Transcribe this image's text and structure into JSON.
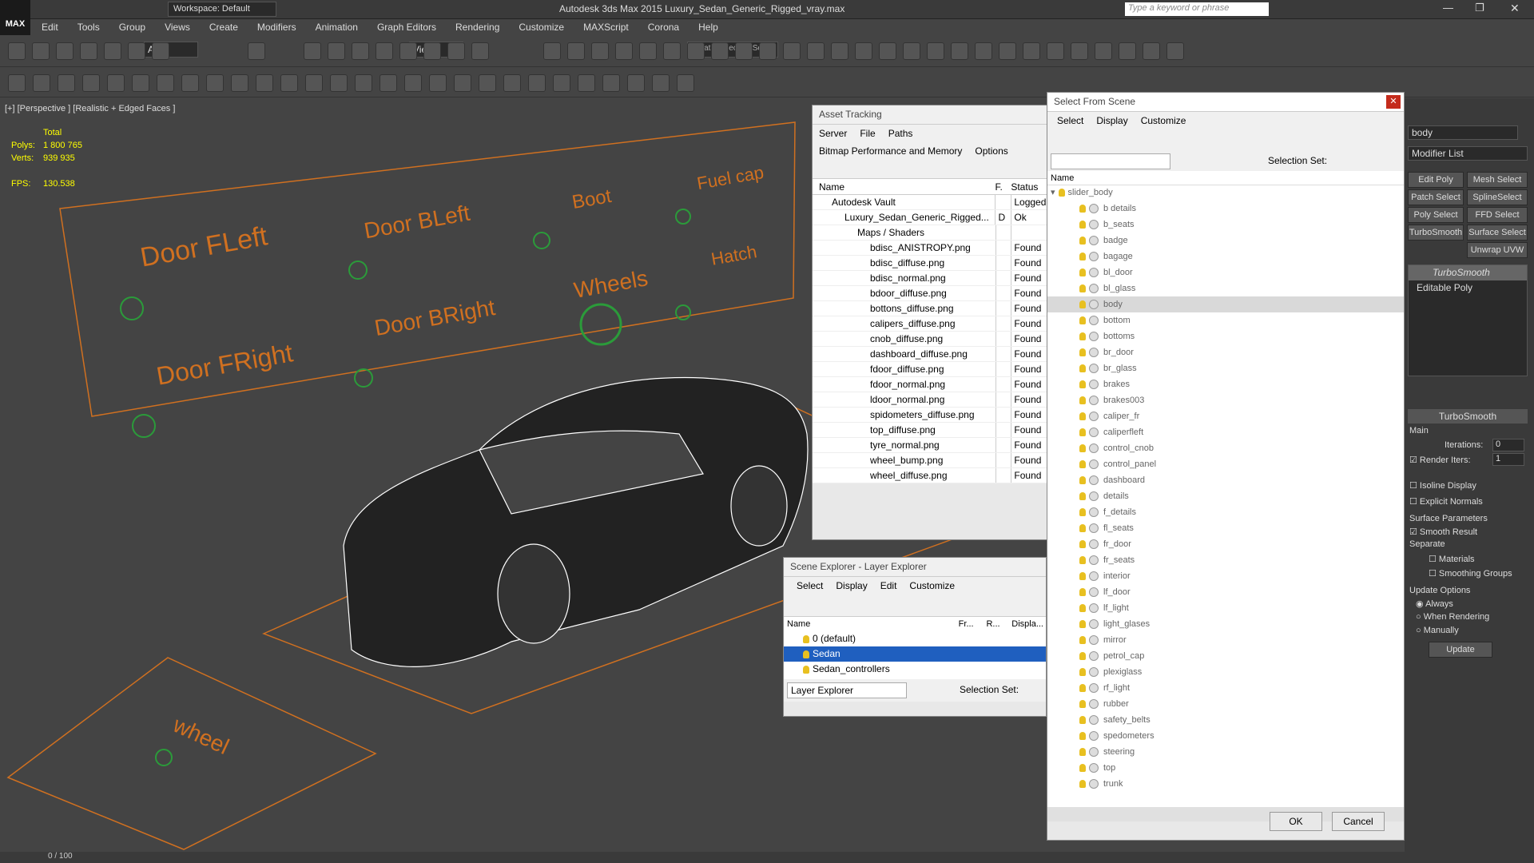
{
  "window": {
    "title": "Autodesk 3ds Max  2015    Luxury_Sedan_Generic_Rigged_vray.max",
    "workspace": "Workspace: Default",
    "search_placeholder": "Type a keyword or phrase",
    "app_logo": "MAX"
  },
  "menu": [
    "Edit",
    "Tools",
    "Group",
    "Views",
    "Create",
    "Modifiers",
    "Animation",
    "Graph Editors",
    "Rendering",
    "Customize",
    "MAXScript",
    "Corona",
    "Help"
  ],
  "toolbar": {
    "filter": "All",
    "view": "View",
    "selection_set": "Create Selection Se"
  },
  "viewport": {
    "label": "[+] [Perspective ] [Realistic + Edged Faces ]",
    "stats": {
      "total_label": "Total",
      "polys_label": "Polys:",
      "polys": "1 800 765",
      "verts_label": "Verts:",
      "verts": "939 935",
      "fps_label": "FPS:",
      "fps": "130.538"
    },
    "controls": [
      "Door FLeft",
      "Door BLeft",
      "Boot",
      "Fuel cap",
      "Door FRight",
      "Door BRight",
      "Wheels",
      "Hatch",
      "wheel"
    ]
  },
  "asset_tracking": {
    "title": "Asset Tracking",
    "menu": [
      "Server",
      "File",
      "Paths",
      "Bitmap Performance and Memory",
      "Options"
    ],
    "cols": [
      "Name",
      "F.",
      "Status"
    ],
    "rows": [
      {
        "name": "Autodesk Vault",
        "f": "",
        "status": "Logged"
      },
      {
        "name": "Luxury_Sedan_Generic_Rigged...",
        "f": "D",
        "status": "Ok"
      },
      {
        "name": "Maps / Shaders",
        "f": "",
        "status": ""
      },
      {
        "name": "bdisc_ANISTROPY.png",
        "f": "",
        "status": "Found"
      },
      {
        "name": "bdisc_diffuse.png",
        "f": "",
        "status": "Found"
      },
      {
        "name": "bdisc_normal.png",
        "f": "",
        "status": "Found"
      },
      {
        "name": "bdoor_diffuse.png",
        "f": "",
        "status": "Found"
      },
      {
        "name": "bottons_diffuse.png",
        "f": "",
        "status": "Found"
      },
      {
        "name": "calipers_diffuse.png",
        "f": "",
        "status": "Found"
      },
      {
        "name": "cnob_diffuse.png",
        "f": "",
        "status": "Found"
      },
      {
        "name": "dashboard_diffuse.png",
        "f": "",
        "status": "Found"
      },
      {
        "name": "fdoor_diffuse.png",
        "f": "",
        "status": "Found"
      },
      {
        "name": "fdoor_normal.png",
        "f": "",
        "status": "Found"
      },
      {
        "name": "ldoor_normal.png",
        "f": "",
        "status": "Found"
      },
      {
        "name": "spidometers_diffuse.png",
        "f": "",
        "status": "Found"
      },
      {
        "name": "top_diffuse.png",
        "f": "",
        "status": "Found"
      },
      {
        "name": "tyre_normal.png",
        "f": "",
        "status": "Found"
      },
      {
        "name": "wheel_bump.png",
        "f": "",
        "status": "Found"
      },
      {
        "name": "wheel_diffuse.png",
        "f": "",
        "status": "Found"
      }
    ]
  },
  "scene_explorer": {
    "title": "Scene Explorer - Layer Explorer",
    "menu": [
      "Select",
      "Display",
      "Edit",
      "Customize"
    ],
    "cols": [
      "Name",
      "Fr...",
      "R...",
      "Displa..."
    ],
    "layers": [
      "0 (default)",
      "Sedan",
      "Sedan_controllers"
    ],
    "footer_label": "Layer Explorer",
    "selection_set": "Selection Set:"
  },
  "select_from_scene": {
    "title": "Select From Scene",
    "menu": [
      "Select",
      "Display",
      "Customize"
    ],
    "selection_set": "Selection Set:",
    "col": "Name",
    "root": "slider_body",
    "items": [
      "b details",
      "b_seats",
      "badge",
      "bagage",
      "bl_door",
      "bl_glass",
      "body",
      "bottom",
      "bottoms",
      "br_door",
      "br_glass",
      "brakes",
      "brakes003",
      "caliper_fr",
      "caliperfleft",
      "control_cnob",
      "control_panel",
      "dashboard",
      "details",
      "f_details",
      "fl_seats",
      "fr_door",
      "fr_seats",
      "interior",
      "lf_door",
      "lf_light",
      "light_glases",
      "mirror",
      "petrol_cap",
      "plexiglass",
      "rf_light",
      "rubber",
      "safety_belts",
      "spedometers",
      "steering",
      "top",
      "trunk"
    ],
    "ok": "OK",
    "cancel": "Cancel"
  },
  "command_panel": {
    "object_name": "body",
    "modifier_list": "Modifier List",
    "buttons": [
      "Edit Poly",
      "Mesh Select",
      "Patch Select",
      "SplineSelect",
      "Poly Select",
      "FFD Select",
      "TurboSmooth",
      "Surface Select",
      "Unwrap UVW"
    ],
    "stack": [
      "TurboSmooth",
      "Editable Poly"
    ],
    "rollout": "TurboSmooth",
    "main": "Main",
    "iterations_label": "Iterations:",
    "iterations": "0",
    "render_iters_label": "Render Iters:",
    "render_iters": "1",
    "isoline": "Isoline Display",
    "explicit": "Explicit Normals",
    "surface_params": "Surface Parameters",
    "smooth_result": "Smooth Result",
    "separate": "Separate",
    "materials": "Materials",
    "smoothing_groups": "Smoothing Groups",
    "update_options": "Update Options",
    "always": "Always",
    "when_rendering": "When Rendering",
    "manually": "Manually",
    "update": "Update"
  },
  "timeline": {
    "frame": "0 / 100"
  }
}
